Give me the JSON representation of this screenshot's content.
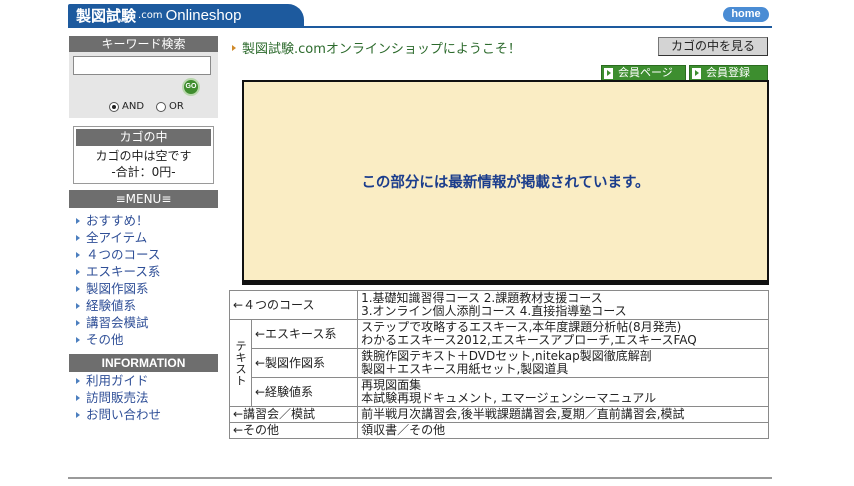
{
  "header": {
    "logo_kanji": "製図試験",
    "logo_com": ".com",
    "logo_shop": "Onlineshop",
    "home_label": "home"
  },
  "sidebar": {
    "keyword_title": "キーワード検索",
    "search_placeholder": "",
    "go_label": "GO",
    "and_label": "AND",
    "or_label": "OR",
    "cart": {
      "title": "カゴの中",
      "empty_text": "カゴの中は空です",
      "total_text": "-合計：0円-"
    },
    "menu_title": "≡MENU≡",
    "menu_items": [
      {
        "label": "おすすめ！"
      },
      {
        "label": "全アイテム"
      },
      {
        "label": "４つのコース"
      },
      {
        "label": "エスキース系"
      },
      {
        "label": "製図作図系"
      },
      {
        "label": "経験値系"
      },
      {
        "label": "講習会模試"
      },
      {
        "label": "その他"
      }
    ],
    "info_title": "INFORMATION",
    "info_items": [
      {
        "label": "利用ガイド"
      },
      {
        "label": "訪問販売法"
      },
      {
        "label": "お問い合わせ"
      }
    ]
  },
  "main": {
    "welcome": "製図試験.comオンラインショップにようこそ！",
    "cart_button": "カゴの中を見る",
    "tab_member": "会員ページ",
    "tab_register": "会員登録",
    "news_text": "この部分には最新情報が掲載されています。",
    "categories": {
      "courses": {
        "label": "←４つのコース",
        "lines": [
          "1.基礎知識習得コース 2.課題教材支援コース",
          "3.オンライン個人添削コース 4.直接指導塾コース"
        ]
      },
      "text_label": "テキスト",
      "esquisse": {
        "label": "←エスキース系",
        "lines": [
          "ステップで攻略するエスキース,本年度課題分析帖(8月発売)",
          "わかるエスキース2012,エスキースアプローチ,エスキースFAQ"
        ]
      },
      "drafting": {
        "label": "←製図作図系",
        "lines": [
          "鉄腕作図テキスト＋DVDセット,nitekap製図徹底解剖",
          "製図＋エスキース用紙セット,製図道具"
        ]
      },
      "experience": {
        "label": "←経験値系",
        "lines": [
          "再現図面集",
          "本試験再現ドキュメント, エマージェンシーマニュアル"
        ]
      },
      "seminar": {
        "label": "←講習会／模試",
        "text": "前半戦月次講習会,後半戦課題講習会,夏期／直前講習会,模試"
      },
      "other": {
        "label": "←その他",
        "text": "領収書／その他"
      }
    }
  }
}
